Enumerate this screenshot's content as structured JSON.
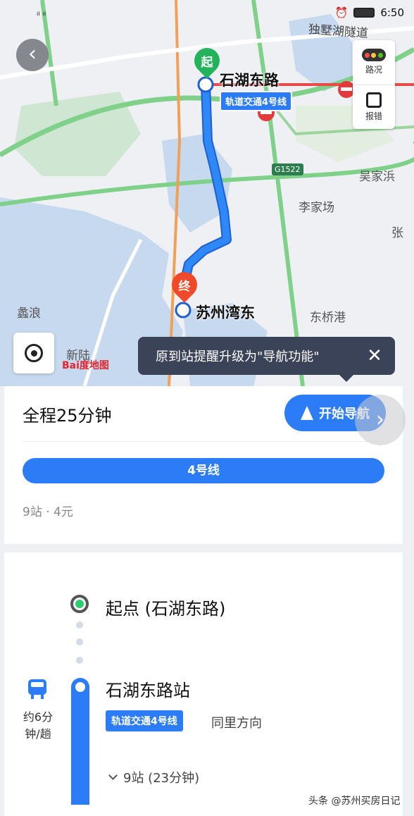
{
  "status": {
    "time": "6:50"
  },
  "map": {
    "labels": {
      "lake": "独墅湖隧道",
      "town1": "吴家浜",
      "town2": "李家场",
      "town3": "东桥港",
      "town4": "蠡浪",
      "town5": "新陆",
      "town6": "张",
      "highway": "G1522"
    },
    "start_pin": "起",
    "end_pin": "终",
    "start_station": "石湖东路",
    "end_station": "苏州湾东",
    "line_tag": "轨道交通4号线",
    "tools": {
      "traffic": "路况",
      "report": "报错"
    },
    "baidu_logo": "Bai度地图",
    "tooltip": "原到站提醒升级为\"导航功能\"",
    "route_color": "#2b7cf6"
  },
  "summary": {
    "total_time": "全程25分钟",
    "nav_button": "开始导航",
    "line_name": "4号线",
    "meta": "9站 · 4元"
  },
  "steps": {
    "start": "起点 (石湖东路)",
    "station": "石湖东路站",
    "frequency_line1": "约6分",
    "frequency_line2": "钟/趟",
    "line_chip": "轨道交通4号线",
    "direction": "同里方向",
    "stops": "9站 (23分钟)"
  },
  "watermark": "头条 @苏州买房日记"
}
